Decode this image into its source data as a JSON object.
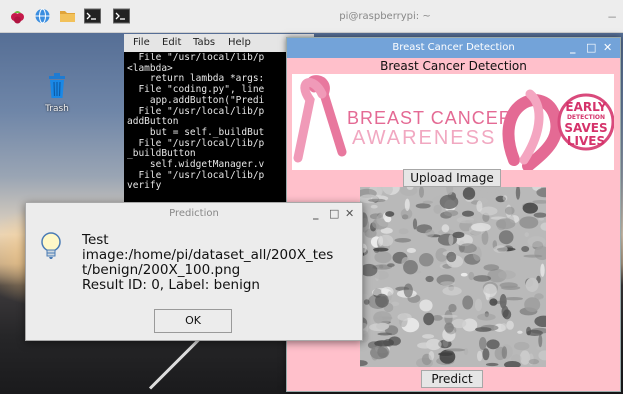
{
  "taskbar": {
    "title": "pi@raspberrypi: ~",
    "launchers": [
      "raspberry-menu-icon",
      "globe-icon",
      "folder-icon",
      "terminal-icon"
    ],
    "task_icon": "terminal-icon",
    "right_glyph": "−"
  },
  "desktop": {
    "trash_label": "Trash"
  },
  "terminal": {
    "menu": [
      "File",
      "Edit",
      "Tabs",
      "Help"
    ],
    "lines": [
      "  File \"/usr/local/lib/p",
      "<lambda>",
      "    return lambda *args:",
      "  File \"coding.py\", line",
      "    app.addButton(\"Predi",
      "  File \"/usr/local/lib/p",
      "addButton",
      "    but = self._buildBut",
      "  File \"/usr/local/lib/p",
      "_buildButton",
      "    self.widgetManager.v",
      "  File \"/usr/local/lib/p",
      "verify"
    ]
  },
  "app": {
    "window_title": "Breast Cancer Detection",
    "heading": "Breast Cancer Detection",
    "controls": [
      "_",
      "□",
      "✕"
    ],
    "banner": {
      "left_line1": "BREAST CANCER",
      "left_line2": "AWARENESS",
      "right_line1": "EARLY",
      "right_line2": "DETECTION",
      "right_line3": "SAVES",
      "right_line4": "LIVES"
    },
    "upload_label": "Upload Image",
    "predict_label": "Predict",
    "colors": {
      "background": "#ffc0cb",
      "titlebar": "#73a3d9",
      "ribbon": "#e8789e"
    }
  },
  "dialog": {
    "title": "Prediction",
    "controls": [
      "_",
      "□",
      "✕"
    ],
    "message_lines": [
      "Test",
      "image:/home/pi/dataset_all/200X_tes",
      "t/benign/200X_100.png",
      "Result ID: 0, Label: benign"
    ],
    "ok_label": "OK",
    "icon": "lightbulb-icon"
  }
}
